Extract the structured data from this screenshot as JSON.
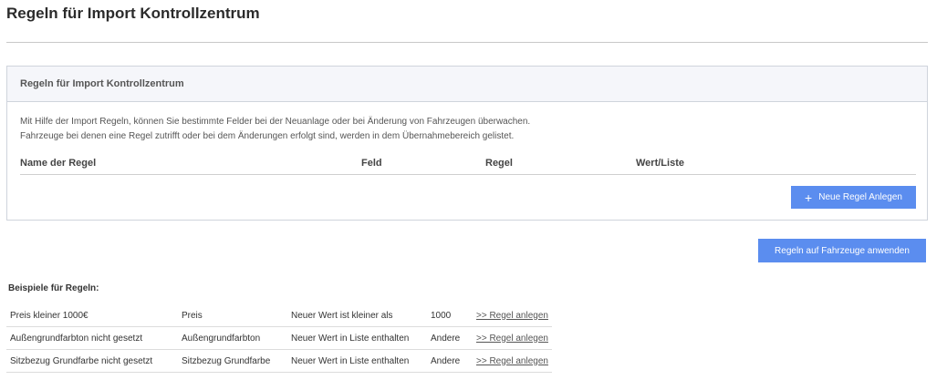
{
  "page": {
    "title": "Regeln für Import Kontrollzentrum"
  },
  "panel": {
    "header": "Regeln für Import Kontrollzentrum",
    "description_lines": [
      "Mit Hilfe der Import Regeln, können Sie bestimmte Felder bei der Neuanlage oder bei Änderung von Fahrzeugen überwachen.",
      "Fahrzeuge bei denen eine Regel zutrifft oder bei dem Änderungen erfolgt sind, werden in dem Übernahmebereich gelistet."
    ],
    "columns": [
      "Name der Regel",
      "Feld",
      "Regel",
      "Wert/Liste"
    ],
    "new_rule_button": "Neue Regel Anlegen"
  },
  "apply_button": "Regeln auf Fahrzeuge anwenden",
  "examples": {
    "title": "Beispiele für Regeln:",
    "rows": [
      {
        "name": "Preis kleiner 1000€",
        "field": "Preis",
        "rule": "Neuer Wert ist kleiner als",
        "value": "1000",
        "action": ">> Regel anlegen"
      },
      {
        "name": "Außengrundfarbton nicht gesetzt",
        "field": "Außengrundfarbton",
        "rule": "Neuer Wert in Liste enthalten",
        "value": "Andere",
        "action": ">> Regel anlegen"
      },
      {
        "name": "Sitzbezug Grundfarbe nicht gesetzt",
        "field": "Sitzbezug Grundfarbe",
        "rule": "Neuer Wert in Liste enthalten",
        "value": "Andere",
        "action": ">> Regel anlegen"
      }
    ]
  },
  "colors": {
    "accent": "#5b8def",
    "panel_header_bg": "#f5f6fa",
    "border": "#cfd4dc"
  },
  "icons": {
    "new_rule": "plus-icon"
  }
}
